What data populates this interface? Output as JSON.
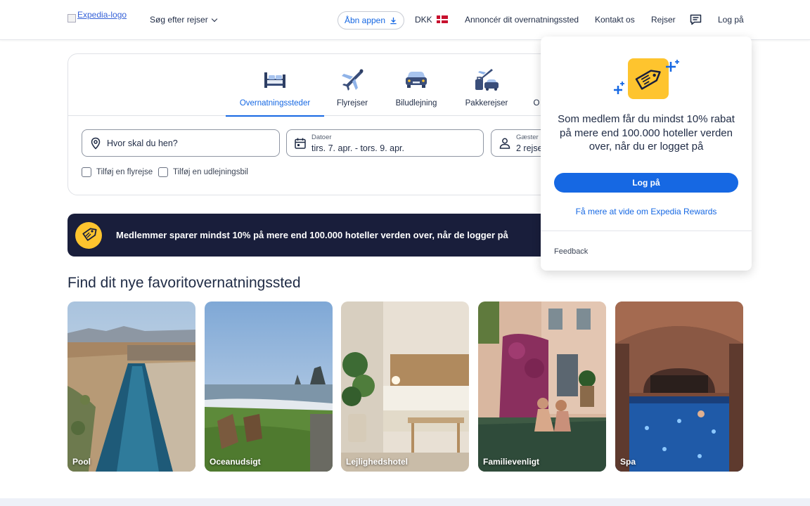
{
  "header": {
    "logo_alt": "Expedia-logo",
    "search_menu": "Søg efter rejser",
    "app_button": "Åbn appen",
    "currency": "DKK",
    "advertise": "Annoncér dit overnatningssted",
    "contact": "Kontakt os",
    "trips": "Rejser",
    "login": "Log på"
  },
  "search": {
    "tabs": [
      {
        "label": "Overnatningssteder",
        "icon": "bed-icon",
        "active": true
      },
      {
        "label": "Flyrejser",
        "icon": "plane-icon",
        "active": false
      },
      {
        "label": "Biludlejning",
        "icon": "car-icon",
        "active": false
      },
      {
        "label": "Pakkerejser",
        "icon": "package-icon",
        "active": false
      },
      {
        "label": "O",
        "icon": "more-icon",
        "active": false
      }
    ],
    "destination_placeholder": "Hvor skal du hen?",
    "dates_label": "Datoer",
    "dates_value": "tirs. 7. apr. - tors. 9. apr.",
    "guests_label": "Gæster",
    "guests_value": "2 rejse",
    "add_flight": "Tilføj en flyrejse",
    "add_car": "Tilføj en udlejningsbil"
  },
  "banner": {
    "text": "Medlemmer sparer mindst 10% på mere end 100.000 hoteller verden over, når de logger på"
  },
  "section": {
    "title": "Find dit nye favoritovernatningssted",
    "cards": [
      {
        "label": "Pool"
      },
      {
        "label": "Oceanudsigt"
      },
      {
        "label": "Lejlighedshotel"
      },
      {
        "label": "Familievenligt"
      },
      {
        "label": "Spa"
      }
    ]
  },
  "popup": {
    "text": "Som medlem får du mindst 10% rabat på mere end 100.000 hoteller verden over, når du er logget på",
    "login_button": "Log på",
    "rewards_link": "Få mere at vide om Expedia Rewards",
    "feedback": "Feedback"
  },
  "colors": {
    "primary": "#1668e3",
    "navy": "#191e3b",
    "yellow": "#fec42e",
    "text": "#1f2b45"
  }
}
